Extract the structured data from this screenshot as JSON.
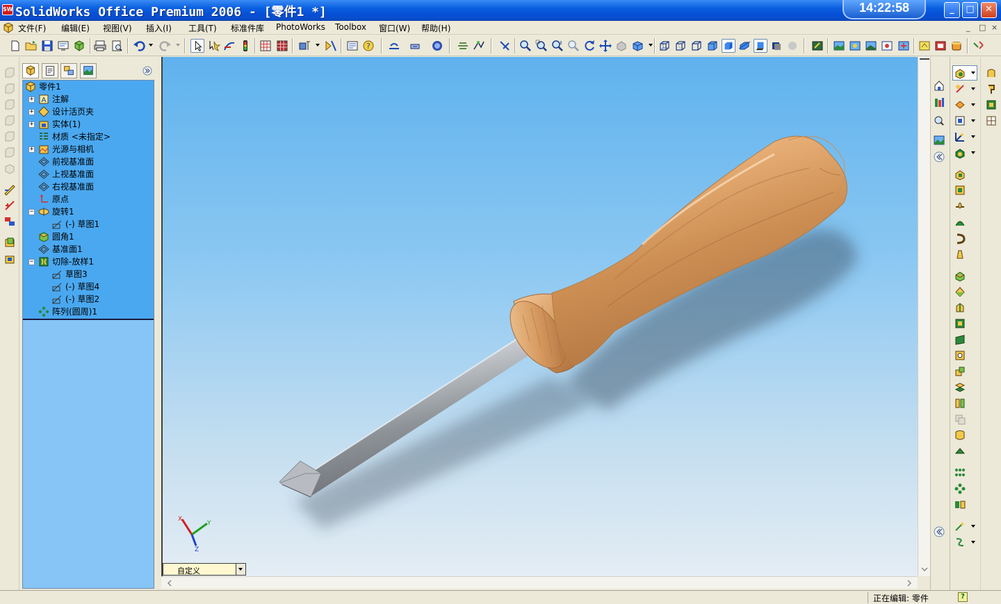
{
  "window": {
    "title": "SolidWorks Office Premium 2006 - [零件1 *]",
    "clock": "14:22:58",
    "app_icon_text": "SW",
    "minimize": "_",
    "maximize": "□",
    "close": "✕"
  },
  "menu": {
    "items": [
      "文件(F)",
      "编辑(E)",
      "视图(V)",
      "插入(I)",
      "工具(T)",
      "标准件库",
      "PhotoWorks",
      "Toolbox",
      "窗口(W)",
      "帮助(H)"
    ],
    "doc_controls": [
      "_",
      "□",
      "×"
    ]
  },
  "feature_tree": {
    "items": [
      {
        "label": "零件1",
        "icon": "part-icon",
        "expander": ""
      },
      {
        "label": "注解",
        "icon": "annotations-icon",
        "expander": "+"
      },
      {
        "label": "设计活页夹",
        "icon": "design-binder-icon",
        "expander": "+"
      },
      {
        "label": "实体(1)",
        "icon": "solid-bodies-icon",
        "expander": "+"
      },
      {
        "label": "材质 <未指定>",
        "icon": "material-icon",
        "expander": ""
      },
      {
        "label": "光源与相机",
        "icon": "lights-cameras-icon",
        "expander": "+"
      },
      {
        "label": "前视基准面",
        "icon": "plane-icon",
        "expander": ""
      },
      {
        "label": "上视基准面",
        "icon": "plane-icon",
        "expander": ""
      },
      {
        "label": "右视基准面",
        "icon": "plane-icon",
        "expander": ""
      },
      {
        "label": "原点",
        "icon": "origin-icon",
        "expander": ""
      },
      {
        "label": "旋转1",
        "icon": "revolve-icon",
        "expander": "−"
      },
      {
        "label": "(-) 草图1",
        "icon": "sketch-icon",
        "expander": ""
      },
      {
        "label": "圆角1",
        "icon": "fillet-icon",
        "expander": ""
      },
      {
        "label": "基准面1",
        "icon": "plane-icon",
        "expander": ""
      },
      {
        "label": "切除-放样1",
        "icon": "cut-loft-icon",
        "expander": "−"
      },
      {
        "label": "草图3",
        "icon": "sketch-icon",
        "expander": ""
      },
      {
        "label": "(-) 草图4",
        "icon": "sketch-icon",
        "expander": ""
      },
      {
        "label": "(-) 草图2",
        "icon": "sketch-icon",
        "expander": ""
      },
      {
        "label": "阵列(圆周)1",
        "icon": "circular-pattern-icon",
        "expander": ""
      }
    ]
  },
  "viewport": {
    "view_orientation": "自定义",
    "triad": {
      "x": "X",
      "y": "Y",
      "z": "Z"
    },
    "model": "screwdriver",
    "handle_color": "#d9a06a",
    "shaft_color": "#a8adb4",
    "background_top": "#5fb2ee",
    "background_bottom": "#e4edf4"
  },
  "status": {
    "text": "正在编辑: 零件",
    "help": "?"
  }
}
